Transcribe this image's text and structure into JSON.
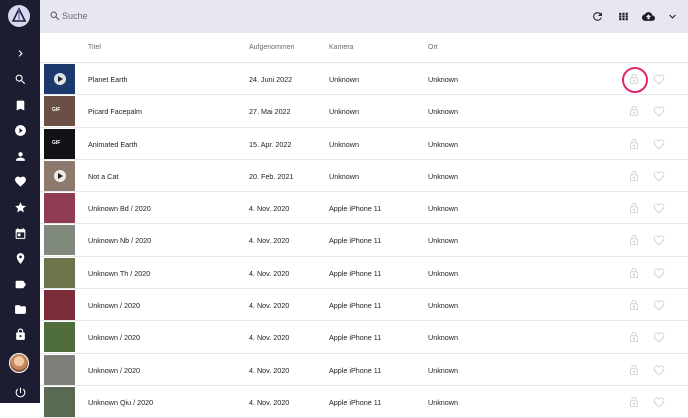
{
  "search": {
    "placeholder": "Suche"
  },
  "columns": {
    "title": "Titel",
    "taken": "Aufgenommen",
    "camera": "Kamera",
    "location": "Ort"
  },
  "nav": [
    "chevron-right-icon",
    "search-icon",
    "bookmark-icon",
    "play-circle-icon",
    "person-icon",
    "heart-icon",
    "star-icon",
    "calendar-icon",
    "place-icon",
    "label-icon",
    "folder-icon",
    "lock-icon"
  ],
  "rows": [
    {
      "title": "Planet Earth",
      "taken": "24. Juni 2022",
      "camera": "Unknown",
      "location": "Unknown",
      "thumb": "#1b3a6b",
      "badge": "play"
    },
    {
      "title": "Picard Facepalm",
      "taken": "27. Mai 2022",
      "camera": "Unknown",
      "location": "Unknown",
      "thumb": "#6b4f44",
      "badge": "GIF"
    },
    {
      "title": "Animated Earth",
      "taken": "15. Apr. 2022",
      "camera": "Unknown",
      "location": "Unknown",
      "thumb": "#101216",
      "badge": "GIF"
    },
    {
      "title": "Not a Cat",
      "taken": "20. Feb. 2021",
      "camera": "Unknown",
      "location": "Unknown",
      "thumb": "#8c7a6e",
      "badge": "play"
    },
    {
      "title": "Unknown Bd / 2020",
      "taken": "4. Nov. 2020",
      "camera": "Apple iPhone 11",
      "location": "Unknown",
      "thumb": "#8f3b52",
      "badge": ""
    },
    {
      "title": "Unknown Nb / 2020",
      "taken": "4. Nov. 2020",
      "camera": "Apple iPhone 11",
      "location": "Unknown",
      "thumb": "#7f8a7c",
      "badge": ""
    },
    {
      "title": "Unknown Th / 2020",
      "taken": "4. Nov. 2020",
      "camera": "Apple iPhone 11",
      "location": "Unknown",
      "thumb": "#6c7449",
      "badge": ""
    },
    {
      "title": "Unknown / 2020",
      "taken": "4. Nov. 2020",
      "camera": "Apple iPhone 11",
      "location": "Unknown",
      "thumb": "#7b2e3a",
      "badge": ""
    },
    {
      "title": "Unknown / 2020",
      "taken": "4. Nov. 2020",
      "camera": "Apple iPhone 11",
      "location": "Unknown",
      "thumb": "#4f6d3a",
      "badge": ""
    },
    {
      "title": "Unknown / 2020",
      "taken": "4. Nov. 2020",
      "camera": "Apple iPhone 11",
      "location": "Unknown",
      "thumb": "#7d7f78",
      "badge": ""
    },
    {
      "title": "Unknown Qiu / 2020",
      "taken": "4. Nov. 2020",
      "camera": "Apple iPhone 11",
      "location": "Unknown",
      "thumb": "#5a6a52",
      "badge": ""
    }
  ],
  "colors": {
    "sidebar": "#1c1d30",
    "topbar": "#e6e7f0",
    "highlight": "#e0266f"
  }
}
